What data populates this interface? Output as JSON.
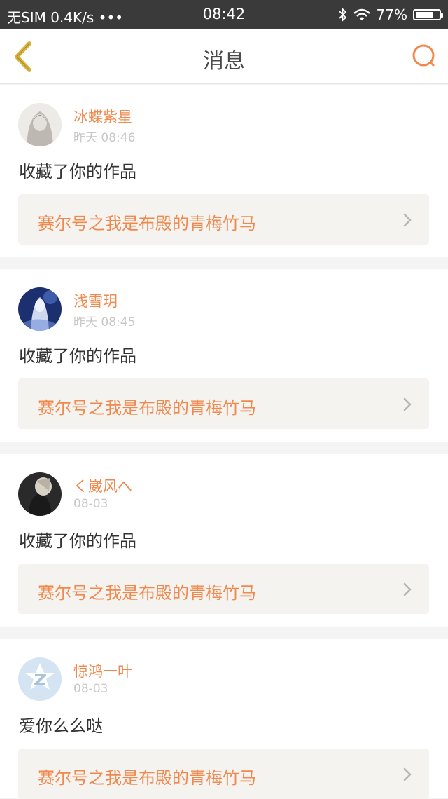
{
  "status_bar": {
    "carrier": "无SIM 0.4K/s •••",
    "time": "08:42",
    "battery": "77%",
    "battery_level": 0.77,
    "icons": [
      "bluetooth-icon",
      "wifi-icon",
      "battery-icon"
    ]
  },
  "nav": {
    "title": "消息",
    "icons": [
      "back-icon",
      "search-icon"
    ]
  },
  "colors": {
    "accent": "#f0894e",
    "back_icon": "#d9b23a",
    "status_bar_bg": "#3a3a3a",
    "link_bg": "#f4f3ef"
  },
  "messages": [
    {
      "user": "冰蝶紫星",
      "time": "昨天 08:46",
      "text": "收藏了你的作品",
      "work": "赛尔号之我是布殿的青梅竹马"
    },
    {
      "user": "浅雪玥",
      "time": "昨天 08:45",
      "text": "收藏了你的作品",
      "work": "赛尔号之我是布殿的青梅竹马"
    },
    {
      "user": "く崴风へ",
      "time": "08-03",
      "text": "收藏了你的作品",
      "work": "赛尔号之我是布殿的青梅竹马"
    },
    {
      "user": "惊鸿一叶",
      "time": "08-03",
      "text": "爱你么么哒",
      "work": "赛尔号之我是布殿的青梅竹马"
    }
  ]
}
